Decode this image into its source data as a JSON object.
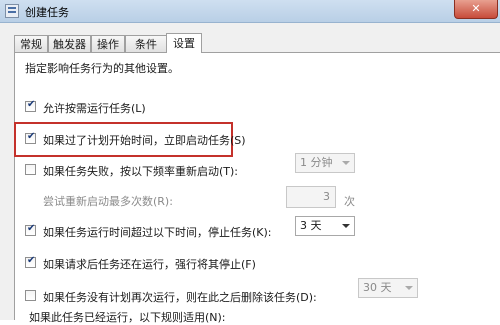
{
  "window": {
    "title": "创建任务",
    "close_symbol": "✕"
  },
  "tabs": [
    {
      "label": "常规"
    },
    {
      "label": "触发器"
    },
    {
      "label": "操作"
    },
    {
      "label": "条件"
    },
    {
      "label": "设置",
      "active": true
    }
  ],
  "settings": {
    "intro": "指定影响任务行为的其他设置。",
    "allow_on_demand": {
      "label": "允许按需运行任务(L)",
      "checked": true
    },
    "run_asap_if_missed": {
      "label": "如果过了计划开始时间，立即启动任务(S)",
      "checked": true
    },
    "restart_on_fail": {
      "label": "如果任务失败，按以下频率重新启动(T):",
      "checked": false,
      "interval_value": "1 分钟"
    },
    "restart_attempts": {
      "label": "尝试重新启动最多次数(R):",
      "value": "3",
      "unit": "次"
    },
    "stop_if_runs_longer": {
      "label": "如果任务运行时间超过以下时间，停止任务(K):",
      "checked": true,
      "value": "3 天"
    },
    "force_stop": {
      "label": "如果请求后任务还在运行，强行将其停止(F)",
      "checked": true
    },
    "delete_if_not_scheduled": {
      "label": "如果任务没有计划再次运行，则在此之后删除该任务(D):",
      "checked": false,
      "value": "30 天"
    },
    "already_running": {
      "label": "如果此任务已经运行，以下规则适用(N):"
    }
  },
  "colors": {
    "highlight_border": "#c4312b"
  },
  "icons": {
    "check": "✔"
  }
}
